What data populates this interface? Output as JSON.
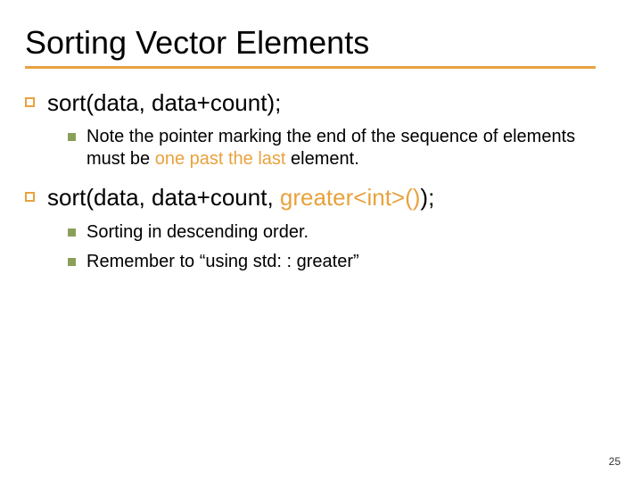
{
  "title": "Sorting Vector Elements",
  "items": [
    {
      "heading": "sort(data, data+count);",
      "children": [
        {
          "pre": "Note the pointer marking the end of the sequence of elements must be ",
          "accent1": "one past the last",
          "post": " element."
        }
      ]
    },
    {
      "heading_pre": "sort(data, data+count, ",
      "heading_accent": "greater<int>()",
      "heading_post": ");",
      "children": [
        {
          "pre": "Sorting in descending order."
        },
        {
          "pre": "Remember to “using std: : greater”"
        }
      ]
    }
  ],
  "page_number": "25",
  "colors": {
    "accent": "#e8a23d",
    "bullet2": "#8aa05a"
  }
}
